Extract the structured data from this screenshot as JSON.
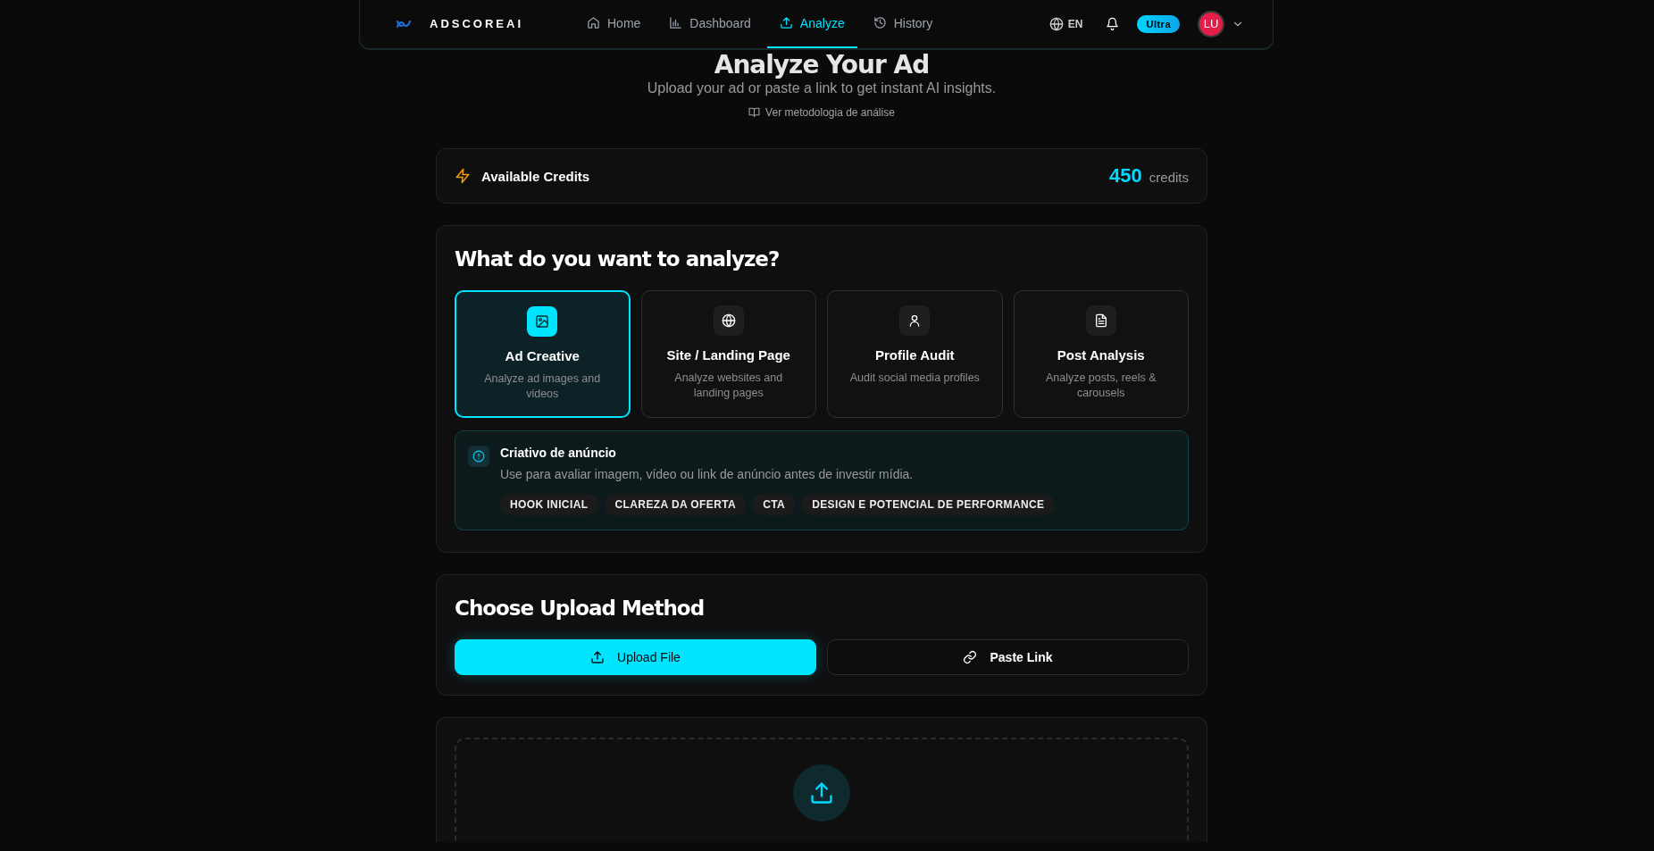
{
  "nav": {
    "brand": "ADSCOREAI",
    "links": [
      {
        "label": "Home",
        "selected": false
      },
      {
        "label": "Dashboard",
        "selected": false
      },
      {
        "label": "Analyze",
        "selected": true
      },
      {
        "label": "History",
        "selected": false
      }
    ],
    "language": "EN",
    "plan_badge": "Ultra",
    "avatar": "LU"
  },
  "header": {
    "title": "Analyze Your Ad",
    "subtitle": "Upload your ad or paste a link to get instant AI insights.",
    "methodology_link": "Ver metodologia de análise"
  },
  "credits": {
    "label": "Available Credits",
    "amount": "450",
    "unit": "credits"
  },
  "analysis_types": {
    "heading": "What do you want to analyze?",
    "options": [
      {
        "title": "Ad Creative",
        "description": "Analyze ad images and videos",
        "selected": true
      },
      {
        "title": "Site / Landing Page",
        "description": "Analyze websites and landing pages",
        "selected": false
      },
      {
        "title": "Profile Audit",
        "description": "Audit social media profiles",
        "selected": false
      },
      {
        "title": "Post Analysis",
        "description": "Analyze posts, reels & carousels",
        "selected": false
      }
    ]
  },
  "info": {
    "title": "Criativo de anúncio",
    "description": "Use para avaliar imagem, vídeo ou link de anúncio antes de investir mídia.",
    "tags": [
      "HOOK INICIAL",
      "CLAREZA DA OFERTA",
      "CTA",
      "DESIGN E POTENCIAL DE PERFORMANCE"
    ]
  },
  "upload_method": {
    "heading": "Choose Upload Method",
    "options": [
      {
        "label": "Upload File",
        "selected": true
      },
      {
        "label": "Paste Link",
        "selected": false
      }
    ]
  }
}
